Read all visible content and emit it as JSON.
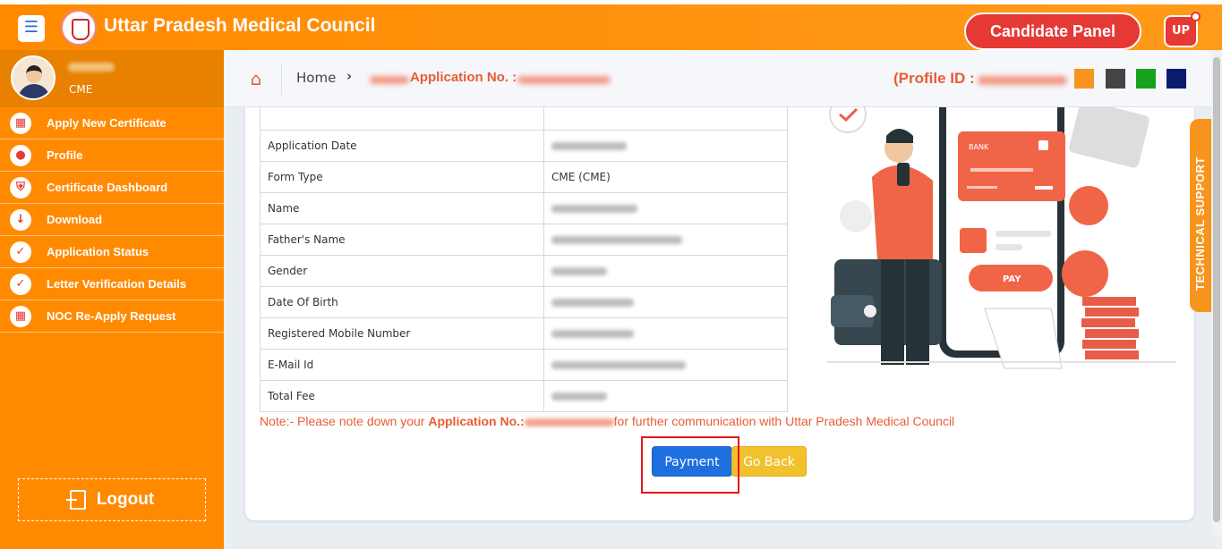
{
  "header": {
    "menu_icon": "hamburger-icon",
    "title": "Uttar Pradesh Medical Council",
    "candidate_panel": "Candidate Panel",
    "badge": "UP"
  },
  "sidebar": {
    "role": "CME",
    "items": [
      {
        "label": "Apply New Certificate",
        "icon": "grid-icon"
      },
      {
        "label": "Profile",
        "icon": "user-icon"
      },
      {
        "label": "Certificate Dashboard",
        "icon": "shield-icon"
      },
      {
        "label": "Download",
        "icon": "download-icon"
      },
      {
        "label": "Application Status",
        "icon": "check-circle-icon"
      },
      {
        "label": "Letter Verification Details",
        "icon": "check-circle-icon"
      },
      {
        "label": "NOC Re-Apply Request",
        "icon": "grid-icon"
      }
    ],
    "logout": "Logout"
  },
  "breadcrumb": {
    "home": "Home",
    "application": "Application No. :",
    "profile_id": "(Profile ID :"
  },
  "colors": {
    "accent": "#ff8a00",
    "swatches": [
      "#f7941d",
      "#444444",
      "#16a21d",
      "#0b1b6e"
    ]
  },
  "details": {
    "rows": [
      {
        "label": "Application Date",
        "value": ""
      },
      {
        "label": "Form Type",
        "value": "CME (CME)"
      },
      {
        "label": "Name",
        "value": ""
      },
      {
        "label": "Father's Name",
        "value": ""
      },
      {
        "label": "Gender",
        "value": ""
      },
      {
        "label": "Date Of Birth",
        "value": ""
      },
      {
        "label": "Registered Mobile Number",
        "value": ""
      },
      {
        "label": "E-Mail Id",
        "value": ""
      },
      {
        "label": "Total Fee",
        "value": ""
      }
    ]
  },
  "note": {
    "prefix": "Note:- Please note down your ",
    "bold": "Application No.:",
    "suffix": "for further communication with Uttar Pradesh Medical Council"
  },
  "buttons": {
    "payment": "Payment",
    "go_back": "Go Back"
  },
  "illustration": {
    "card_text": "BANK",
    "pay_button": "PAY"
  },
  "technical_support": "TECHNICAL SUPPORT"
}
